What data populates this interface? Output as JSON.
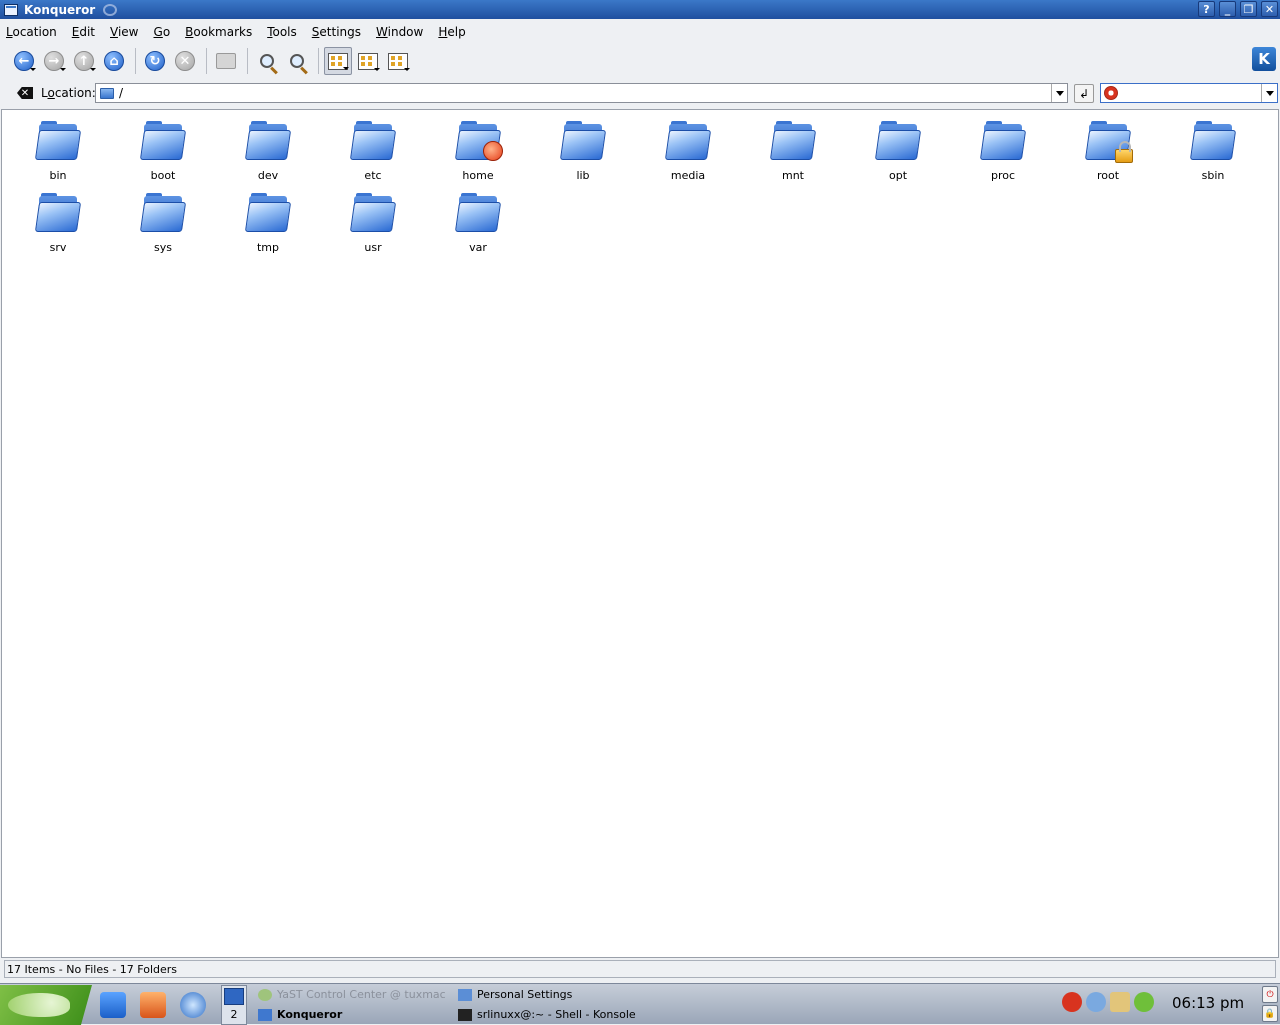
{
  "window": {
    "title": "Konqueror"
  },
  "menubar": {
    "items": [
      {
        "label": "Location",
        "key": "L",
        "rest": "ocation"
      },
      {
        "label": "Edit",
        "key": "E",
        "rest": "dit"
      },
      {
        "label": "View",
        "key": "V",
        "rest": "iew"
      },
      {
        "label": "Go",
        "key": "G",
        "rest": "o"
      },
      {
        "label": "Bookmarks",
        "key": "B",
        "rest": "ookmarks"
      },
      {
        "label": "Tools",
        "key": "T",
        "rest": "ools"
      },
      {
        "label": "Settings",
        "key": "S",
        "rest": "ettings"
      },
      {
        "label": "Window",
        "key": "W",
        "rest": "indow"
      },
      {
        "label": "Help",
        "key": "H",
        "rest": "elp"
      }
    ]
  },
  "locationbar": {
    "label_pre": "L",
    "label_key": "o",
    "label_post": "cation:",
    "value": "/"
  },
  "files": [
    {
      "name": "bin",
      "badge": ""
    },
    {
      "name": "boot",
      "badge": ""
    },
    {
      "name": "dev",
      "badge": ""
    },
    {
      "name": "etc",
      "badge": ""
    },
    {
      "name": "home",
      "badge": "home"
    },
    {
      "name": "lib",
      "badge": ""
    },
    {
      "name": "media",
      "badge": ""
    },
    {
      "name": "mnt",
      "badge": ""
    },
    {
      "name": "opt",
      "badge": ""
    },
    {
      "name": "proc",
      "badge": ""
    },
    {
      "name": "root",
      "badge": "lock"
    },
    {
      "name": "sbin",
      "badge": ""
    },
    {
      "name": "srv",
      "badge": ""
    },
    {
      "name": "sys",
      "badge": ""
    },
    {
      "name": "tmp",
      "badge": ""
    },
    {
      "name": "usr",
      "badge": ""
    },
    {
      "name": "var",
      "badge": ""
    }
  ],
  "statusbar": {
    "text": "17 Items - No Files - 17 Folders"
  },
  "taskbar": {
    "pager_desktop": "2",
    "tasks": {
      "yast": "YaST Control Center @ tuxmac",
      "konqueror": "Konqueror",
      "personal": "Personal Settings",
      "konsole": "srlinuxx@:~ - Shell - Konsole"
    },
    "clock": "06:13 pm"
  },
  "colors": {
    "accent": "#1f4f9f",
    "folder": "#2a6ad3"
  }
}
